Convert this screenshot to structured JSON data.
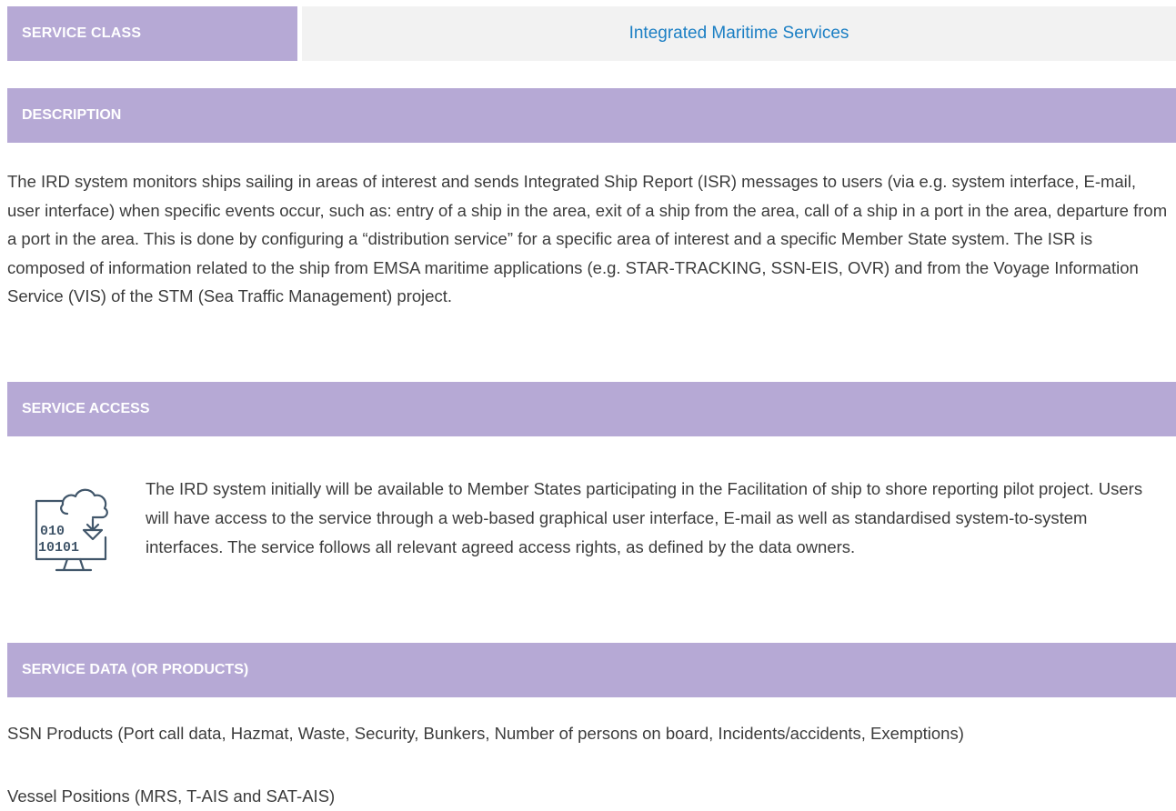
{
  "service_class": {
    "label": "SERVICE CLASS",
    "value": "Integrated Maritime Services"
  },
  "description": {
    "heading": "DESCRIPTION",
    "text": "The IRD system monitors ships sailing in areas of interest and sends Integrated Ship Report (ISR) messages to users (via e.g. system interface, E-mail, user interface) when specific events occur, such as: entry of a ship in the area, exit of a ship from the area, call of a ship in a port in the area, departure from a port in the area. This is done by configuring a “distribution service” for a specific area of interest and a specific Member State system. The ISR is composed of information related to the ship from EMSA maritime applications (e.g. STAR-TRACKING, SSN-EIS, OVR) and from the Voyage Information Service (VIS) of the STM (Sea Traffic Management) project."
  },
  "service_access": {
    "heading": "SERVICE ACCESS",
    "icon": "cloud-data-terminal-icon",
    "icon_text_top": "010",
    "icon_text_bottom": "10101",
    "text": "The IRD system initially will be available to Member States participating in the Facilitation of ship to shore reporting pilot project. Users will have access to the service through a web-based graphical user interface, E-mail as well as standardised system-to-system interfaces. The service follows all relevant agreed access rights, as defined by the data owners."
  },
  "service_data": {
    "heading": "SERVICE DATA (OR PRODUCTS)",
    "items": [
      "SSN Products (Port call data, Hazmat, Waste, Security, Bunkers, Number of persons on board, Incidents/accidents, Exemptions)",
      "Vessel Positions (MRS, T-AIS and SAT-AIS)"
    ]
  },
  "colors": {
    "section_bar": "#b6a9d5",
    "value_bg": "#f2f2f2",
    "value_text": "#1b7fc4",
    "body_text": "#3c3c3c",
    "icon_stroke": "#41566a"
  }
}
